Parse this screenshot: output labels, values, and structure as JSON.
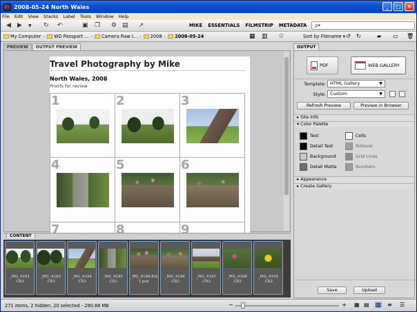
{
  "window": {
    "title": "2008-05-24 North Wales",
    "app_icon": "Br",
    "controls": [
      "_",
      "□",
      "✕"
    ]
  },
  "menu": [
    "File",
    "Edit",
    "View",
    "Stacks",
    "Label",
    "Tools",
    "Window",
    "Help"
  ],
  "workspaces": [
    "MIKE",
    "ESSENTIALS",
    "FILMSTRIP",
    "METADATA"
  ],
  "search": {
    "placeholder": "ρ▾"
  },
  "path": {
    "items": [
      "My Computer",
      "WD Passport ...",
      "Camera Raw I...",
      "2008",
      "2008-05-24"
    ],
    "separator": "›"
  },
  "sort": {
    "label": "Sort by Filename ▾"
  },
  "left_tabs": [
    "PREVIEW",
    "OUTPUT PREVIEW"
  ],
  "preview": {
    "title": "Travel Photography by Mike",
    "subtitle": "North Wales, 2008",
    "caption": "Proofs for review",
    "cells": [
      {
        "num": "1",
        "scene": "trees"
      },
      {
        "num": "2",
        "scene": "trees-dark"
      },
      {
        "num": "3",
        "scene": "house"
      },
      {
        "num": "4",
        "scene": "steps"
      },
      {
        "num": "5",
        "scene": "wall-flowers"
      },
      {
        "num": "6",
        "scene": "wall-flowers-2"
      },
      {
        "num": "7",
        "scene": "none"
      },
      {
        "num": "8",
        "scene": "none"
      },
      {
        "num": "9",
        "scene": "none"
      }
    ]
  },
  "content": {
    "tab": "CONTENT",
    "thumbs": [
      {
        "label1": "_MG_4191",
        "label2": ".CR2",
        "scene": "trees"
      },
      {
        "label1": "_MG_4193",
        "label2": ".CR2",
        "scene": "trees-dark"
      },
      {
        "label1": "_MG_4194",
        "label2": ".CR2",
        "scene": "house"
      },
      {
        "label1": "_MG_4195",
        "label2": ".CR2",
        "scene": "steps"
      },
      {
        "label1": "_MG_4196-Edi",
        "label2": "t.psd",
        "scene": "wall-flowers"
      },
      {
        "label1": "_MG_4196",
        "label2": ".CR2",
        "scene": "wall-flowers-2"
      },
      {
        "label1": "_MG_4197",
        "label2": ".CR2",
        "scene": "house2"
      },
      {
        "label1": "_MG_4198",
        "label2": ".CR2",
        "scene": "flowers"
      },
      {
        "label1": "_MG_4199",
        "label2": ".CR2",
        "scene": "yellow"
      }
    ]
  },
  "status": {
    "text": "271 items, 2 hidden, 20 selected - 290.88 MB"
  },
  "output": {
    "tab": "OUTPUT",
    "pdf_label": "PDF",
    "web_label": "WEB GALLERY",
    "template_label": "Template:",
    "template_value": "HTML Gallery",
    "style_label": "Style:",
    "style_value": "Custom",
    "refresh_label": "Refresh Preview",
    "browser_label": "Preview in Browser",
    "sections": {
      "site_info": "Site Info",
      "color_palette": "Color Palette",
      "appearance": "Appearance",
      "create_gallery": "Create Gallery"
    },
    "swatches_left": [
      {
        "label": "Text",
        "color": "#000000"
      },
      {
        "label": "Detail Text",
        "color": "#000000"
      },
      {
        "label": "Background",
        "color": "#c8c8c8"
      },
      {
        "label": "Detail Matte",
        "color": "#6e6e6e"
      }
    ],
    "swatches_right": [
      {
        "label": "Cells",
        "color": "#ffffff"
      },
      {
        "label": "Rollover",
        "color": "#a0a0a0"
      },
      {
        "label": "Grid Lines",
        "color": "#8c8c8c"
      },
      {
        "label": "Numbers",
        "color": "#9a9a9a"
      }
    ],
    "save_label": "Save",
    "upload_label": "Upload"
  }
}
